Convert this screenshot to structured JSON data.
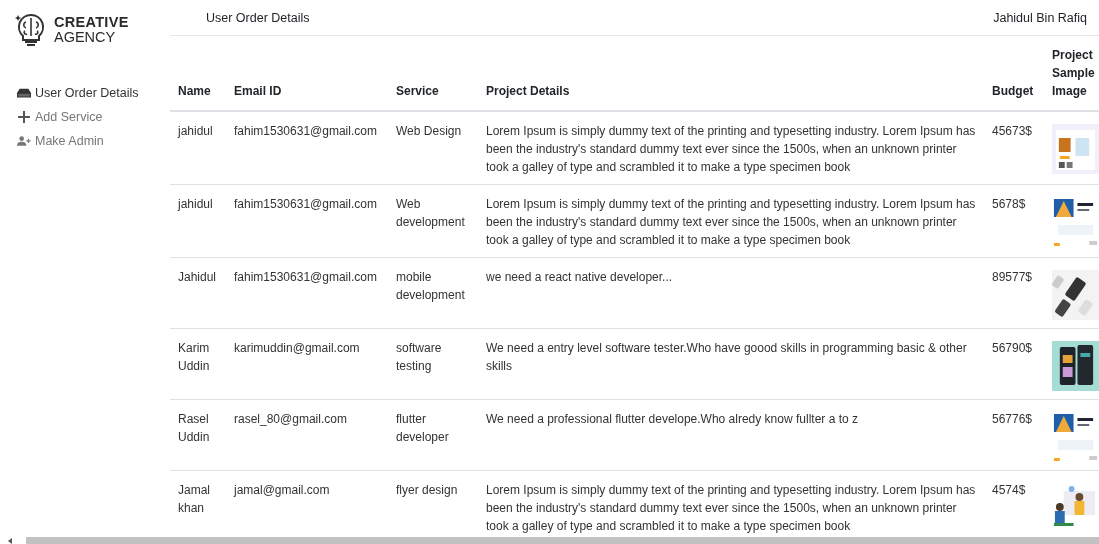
{
  "brand": {
    "line1": "CREATIVE",
    "line2": "AGENCY"
  },
  "header": {
    "title": "User Order Details",
    "user": "Jahidul Bin Rafiq"
  },
  "sidebar": {
    "items": [
      {
        "label": "User Order Details",
        "selected": true
      },
      {
        "label": "Add Service",
        "selected": false
      },
      {
        "label": "Make Admin",
        "selected": false
      }
    ]
  },
  "table": {
    "columns": [
      "Name",
      "Email ID",
      "Service",
      "Project Details",
      "Budget",
      "Project Sample Image"
    ],
    "rows": [
      {
        "name": "jahidul",
        "email": "fahim1530631@gmail.com",
        "service": "Web Design",
        "details": "Lorem Ipsum is simply dummy text of the printing and typesetting industry. Lorem Ipsum has been the industry's standard dummy text ever since the 1500s, when an unknown printer took a galley of type and scrambled it to make a type specimen book",
        "budget": "45673$"
      },
      {
        "name": "jahidul",
        "email": "fahim1530631@gmail.com",
        "service": "Web development",
        "details": "Lorem Ipsum is simply dummy text of the printing and typesetting industry. Lorem Ipsum has been the industry's standard dummy text ever since the 1500s, when an unknown printer took a galley of type and scrambled it to make a type specimen book",
        "budget": "5678$"
      },
      {
        "name": "Jahidul",
        "email": "fahim1530631@gmail.com",
        "service": "mobile development",
        "details": "we need a react native developer...",
        "budget": "89577$"
      },
      {
        "name": "Karim Uddin",
        "email": "karimuddin@gmail.com",
        "service": "software testing",
        "details": "We need a entry level software tester.Who have goood skills in programming basic & other skills",
        "budget": "56790$"
      },
      {
        "name": "Rasel Uddin",
        "email": "rasel_80@gmail.com",
        "service": "flutter developer",
        "details": "We need a professional flutter develope.Who alredy know fullter a to z",
        "budget": "56776$"
      },
      {
        "name": "Jamal khan",
        "email": "jamal@gmail.com",
        "service": "flyer design",
        "details": "Lorem Ipsum is simply dummy text of the printing and typesetting industry. Lorem Ipsum has been the industry's standard dummy text ever since the 1500s, when an unknown printer took a galley of type and scrambled it to make a type specimen book",
        "budget": "4574$"
      }
    ]
  }
}
